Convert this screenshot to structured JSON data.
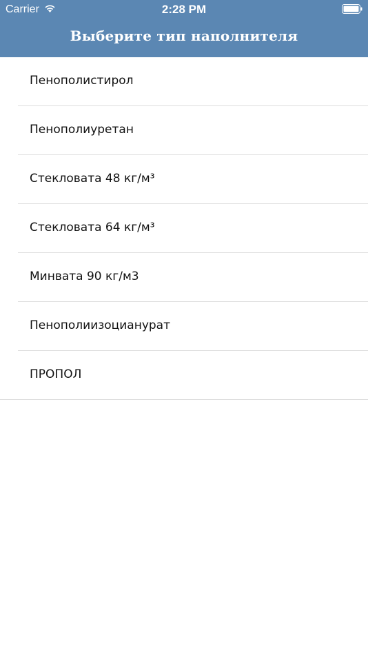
{
  "status_bar": {
    "carrier": "Carrier",
    "time": "2:28 PM",
    "wifi_icon": "wifi-icon",
    "battery_icon": "battery-icon"
  },
  "nav": {
    "title": "Выберите тип наполнителя",
    "background_color": "#5b87b3"
  },
  "list": {
    "items": [
      {
        "label": "Пенополистирол"
      },
      {
        "label": "Пенополиуретан"
      },
      {
        "label": "Стекловата 48 кг/м³"
      },
      {
        "label": "Стекловата 64 кг/м³"
      },
      {
        "label": "Минвата 90 кг/м3"
      },
      {
        "label": "Пенополиизоцианурат"
      },
      {
        "label": "ПРОПОЛ"
      }
    ]
  }
}
